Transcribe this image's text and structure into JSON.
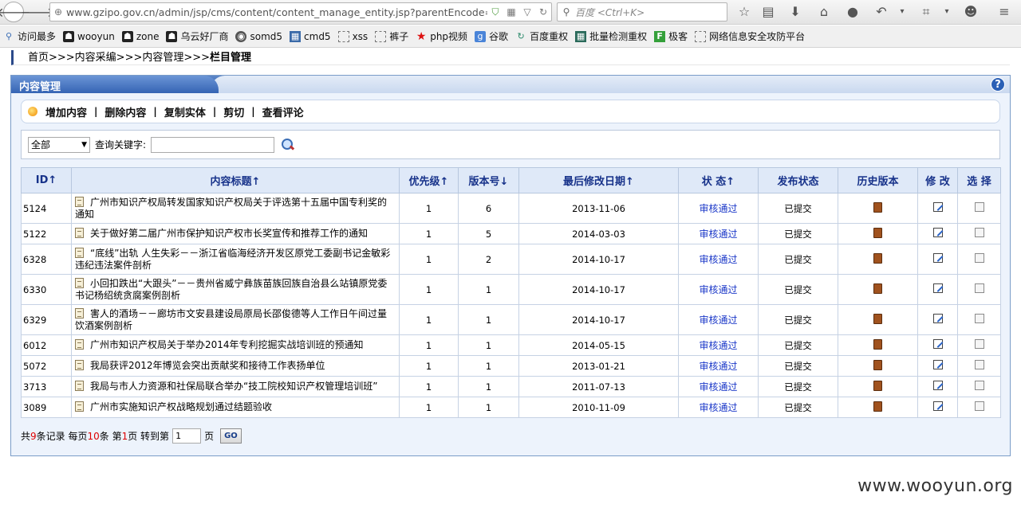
{
  "browser": {
    "url": "www.gzipo.gov.cn/admin/jsp/cms/content/content_manage_entity.jsp?parentEncode=0018",
    "search_placeholder": "百度 <Ctrl+K>"
  },
  "bookmarks": [
    {
      "label": "访问最多",
      "icon": "magnify-icon"
    },
    {
      "label": "wooyun",
      "icon": "wooyun-icon"
    },
    {
      "label": "zone",
      "icon": "wooyun-icon"
    },
    {
      "label": "乌云好厂商",
      "icon": "wooyun-icon"
    },
    {
      "label": "somd5",
      "icon": "somd5-icon"
    },
    {
      "label": "cmd5",
      "icon": "grid-icon"
    },
    {
      "label": "xss",
      "icon": "page-icon"
    },
    {
      "label": "裤子",
      "icon": "page-icon"
    },
    {
      "label": "php视频",
      "icon": "star-icon"
    },
    {
      "label": "谷歌",
      "icon": "google-icon"
    },
    {
      "label": "百度重权",
      "icon": "refresh-icon"
    },
    {
      "label": "批量检测重权",
      "icon": "grid-icon"
    },
    {
      "label": "极客",
      "icon": "f-icon"
    },
    {
      "label": "网络信息安全攻防平台",
      "icon": "page-icon"
    }
  ],
  "breadcrumb": {
    "path": "首页>>>内容采编>>>内容管理>>>",
    "current": "栏目管理"
  },
  "panel": {
    "title": "内容管理",
    "help": "?"
  },
  "actions": {
    "add": "增加内容",
    "delete": "删除内容",
    "copy": "复制实体",
    "cut": "剪切",
    "comments": "查看评论",
    "sep": "|"
  },
  "filter": {
    "select_value": "全部",
    "keyword_label": "查询关键字:"
  },
  "table": {
    "headers": {
      "id": "ID↑",
      "title": "内容标题↑",
      "priority": "优先级↑",
      "version": "版本号↓",
      "modified": "最后修改日期↑",
      "status": "状 态↑",
      "publish": "发布状态",
      "history": "历史版本",
      "edit": "修 改",
      "select": "选 择"
    },
    "rows": [
      {
        "id": "5124",
        "title": "广州市知识产权局转发国家知识产权局关于评选第十五届中国专利奖的通知",
        "priority": "1",
        "version": "6",
        "date": "2013-11-06",
        "status": "审核通过",
        "publish": "已提交"
      },
      {
        "id": "5122",
        "title": "关于做好第二届广州市保护知识产权市长奖宣传和推荐工作的通知",
        "priority": "1",
        "version": "5",
        "date": "2014-03-03",
        "status": "审核通过",
        "publish": "已提交"
      },
      {
        "id": "6328",
        "title": "“底线”出轨 人生失彩－－浙江省临海经济开发区原党工委副书记金敏彩违纪违法案件剖析",
        "priority": "1",
        "version": "2",
        "date": "2014-10-17",
        "status": "审核通过",
        "publish": "已提交"
      },
      {
        "id": "6330",
        "title": "小回扣跌出“大跟头”－－贵州省威宁彝族苗族回族自治县么站镇原党委书记杨绍统贪腐案例剖析",
        "priority": "1",
        "version": "1",
        "date": "2014-10-17",
        "status": "审核通过",
        "publish": "已提交"
      },
      {
        "id": "6329",
        "title": "害人的酒场－－廊坊市文安县建设局原局长邵俊德等人工作日午间过量饮酒案例剖析",
        "priority": "1",
        "version": "1",
        "date": "2014-10-17",
        "status": "审核通过",
        "publish": "已提交"
      },
      {
        "id": "6012",
        "title": "广州市知识产权局关于举办2014年专利挖掘实战培训班的预通知",
        "priority": "1",
        "version": "1",
        "date": "2014-05-15",
        "status": "审核通过",
        "publish": "已提交"
      },
      {
        "id": "5072",
        "title": "我局获评2012年博览会突出贡献奖和接待工作表扬单位",
        "priority": "1",
        "version": "1",
        "date": "2013-01-21",
        "status": "审核通过",
        "publish": "已提交"
      },
      {
        "id": "3713",
        "title": "我局与市人力资源和社保局联合举办“技工院校知识产权管理培训班”",
        "priority": "1",
        "version": "1",
        "date": "2011-07-13",
        "status": "审核通过",
        "publish": "已提交"
      },
      {
        "id": "3089",
        "title": "广州市实施知识产权战略规划通过结题验收",
        "priority": "1",
        "version": "1",
        "date": "2010-11-09",
        "status": "审核通过",
        "publish": "已提交"
      }
    ]
  },
  "pager": {
    "p1": "共",
    "total": "9",
    "p2": "条记录 每页",
    "per_page": "10",
    "p3": "条 第",
    "current": "1",
    "p4": "页 转到第",
    "input": "1",
    "p5": "页",
    "go": "GO"
  },
  "watermark": "www.wooyun.org"
}
